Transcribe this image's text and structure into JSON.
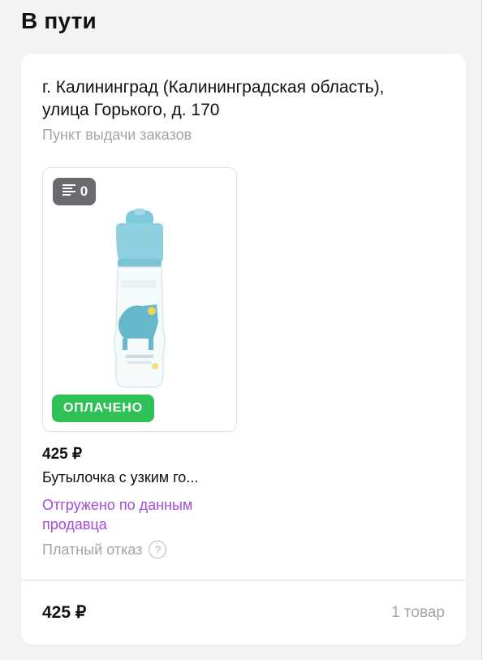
{
  "section": {
    "title": "В пути"
  },
  "order": {
    "address": "г. Калининград (Калининградская область), улица Горького, д. 170",
    "pickup_type": "Пункт выдачи заказов",
    "product": {
      "reviews_icon": "reviews-list-icon",
      "reviews_count": "0",
      "paid_badge": "ОПЛАЧЕНО",
      "price": "425 ₽",
      "name": "Бутылочка с узким го...",
      "shipping_status": "Отгружено по данным продавца",
      "refusal_label": "Платный отказ",
      "help_icon": "question-circle-icon"
    },
    "total_price": "425 ₽",
    "item_count": "1 товар"
  },
  "colors": {
    "paid_badge_bg": "#2fc155",
    "shipping_status": "#a24bdc",
    "secondary_text": "#a3a3ab",
    "reviews_badge_bg": "#6b6b6f"
  }
}
